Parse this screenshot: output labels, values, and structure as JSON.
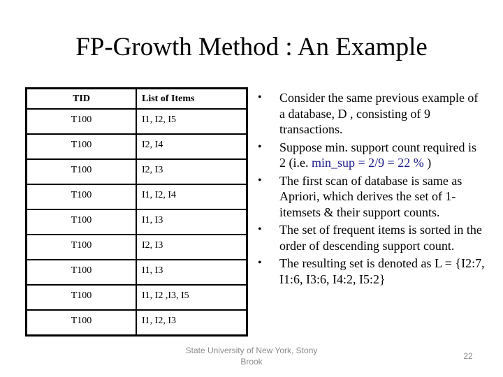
{
  "slide": {
    "title": "FP-Growth Method : An Example",
    "table": {
      "headers": [
        "TID",
        "List of Items"
      ],
      "rows": [
        [
          "T100",
          "I1, I2, I5"
        ],
        [
          "T100",
          "I2, I4"
        ],
        [
          "T100",
          "I2, I3"
        ],
        [
          "T100",
          "I1, I2, I4"
        ],
        [
          "T100",
          "I1, I3"
        ],
        [
          "T100",
          "I2, I3"
        ],
        [
          "T100",
          "I1, I3"
        ],
        [
          "T100",
          "I1, I2 ,I3, I5"
        ],
        [
          "T100",
          "I1, I2, I3"
        ]
      ]
    },
    "bullet_glyph": "•",
    "bullets": [
      {
        "text": "Consider the same previous example of a database, D , consisting of 9 transactions."
      },
      {
        "pre": "Suppose min. support count required is 2 (i.e. ",
        "highlight": "min_sup = 2/9 = 22 %",
        "post": " )"
      },
      {
        "text": "The first scan of database is same as Apriori, which derives the set of 1-itemsets & their support counts."
      },
      {
        "text": "The set of frequent items is sorted in the order of descending support count."
      },
      {
        "text": "The resulting set is denoted as L = {I2:7, I1:6, I3:6, I4:2, I5:2}"
      }
    ],
    "highlight_color": "#1a1a8c",
    "footer": "State University of New York, Stony Brook",
    "page_number": "22"
  }
}
